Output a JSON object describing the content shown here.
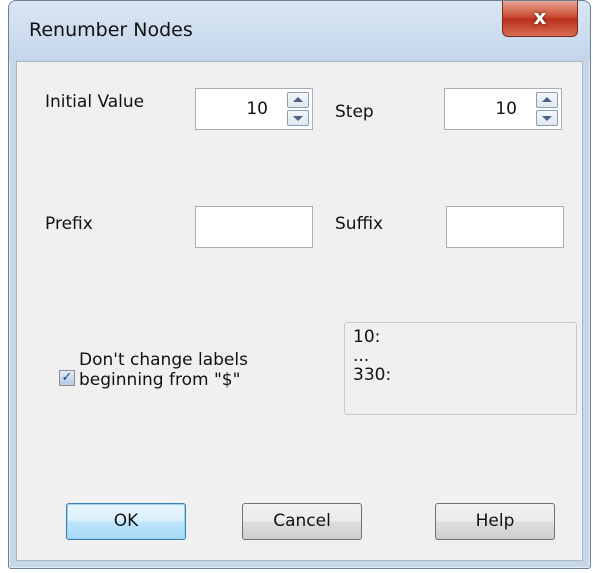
{
  "window": {
    "title": "Renumber Nodes",
    "close_glyph": "x"
  },
  "fields": {
    "initial_value_label": "Initial Value",
    "initial_value": "10",
    "step_label": "Step",
    "step_value": "10",
    "prefix_label": "Prefix",
    "prefix_value": "",
    "suffix_label": "Suffix",
    "suffix_value": ""
  },
  "option": {
    "checked": true,
    "check_glyph": "✓",
    "label_line1": "Don't change labels",
    "label_line2": "beginning from \"$\""
  },
  "preview": {
    "lines": [
      "10:",
      "...",
      "330:"
    ]
  },
  "buttons": {
    "ok": "OK",
    "cancel": "Cancel",
    "help": "Help"
  },
  "colors": {
    "frame": "#c7d7ea",
    "close_button": "#c8442b",
    "default_button": "#bee6fd"
  }
}
